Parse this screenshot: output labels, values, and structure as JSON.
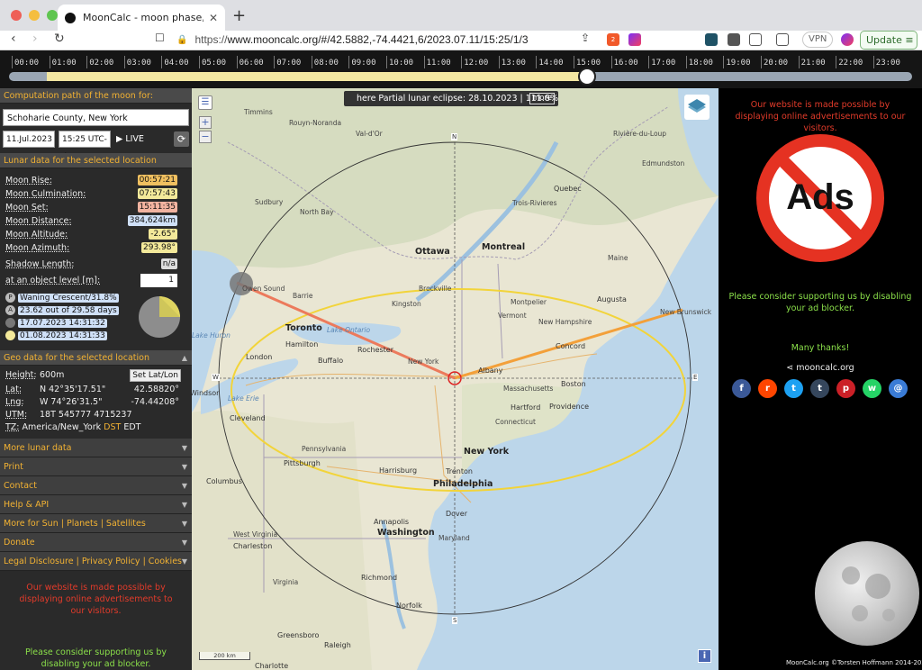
{
  "browser": {
    "tab_title": "MoonCalc - moon phase, lunar",
    "url_scheme": "https://",
    "url_host": "www.mooncalc.org",
    "url_path": "/#/42.5882,-74.4421,6/2023.07.11/15:25/1/3",
    "vpn_label": "VPN",
    "update_label": "Update",
    "shield_badge": "2"
  },
  "timeline": {
    "hours": [
      "00:00",
      "01:00",
      "02:00",
      "03:00",
      "04:00",
      "05:00",
      "06:00",
      "07:00",
      "08:00",
      "09:00",
      "10:00",
      "11:00",
      "12:00",
      "13:00",
      "14:00",
      "15:00",
      "16:00",
      "17:00",
      "18:00",
      "19:00",
      "20:00",
      "21:00",
      "22:00",
      "23:00"
    ],
    "current_time_fraction": 0.64
  },
  "left": {
    "computation_header": "Computation path of the moon for:",
    "location": "Schoharie County, New York",
    "date": "11.Jul.2023",
    "time": "15:25 UTC-4",
    "live_label": "LIVE",
    "lunar_header": "Lunar data for the selected location",
    "lunar": [
      {
        "key": "Moon Rise:",
        "value": "00:57:21",
        "color": "#f0c060"
      },
      {
        "key": "Moon Culmination:",
        "value": "07:57:43",
        "color": "#f3e99a"
      },
      {
        "key": "Moon Set:",
        "value": "15:11:35",
        "color": "#f2b3a0"
      },
      {
        "key": "Moon Distance:",
        "value": "384,624km",
        "color": "#cfe0f7"
      },
      {
        "key": "Moon Altitude:",
        "value": "-2.65°",
        "color": "#f3e99a"
      },
      {
        "key": "Moon Azimuth:",
        "value": "293.98°",
        "color": "#f3e99a"
      }
    ],
    "shadow_label": "Shadow Length:",
    "shadow_value": "n/a",
    "object_label": "at an object level [m]:",
    "object_value": "1",
    "phases": [
      {
        "marker": "P",
        "text": "Waning Crescent/31.8%",
        "dot": "#bbbbbb"
      },
      {
        "marker": "A",
        "text": "23.62 out of 29.58 days",
        "dot": "#bbbbbb"
      },
      {
        "marker": "",
        "text": "17.07.2023 14:31:32",
        "dot": "#777777"
      },
      {
        "marker": "",
        "text": "01.08.2023 14:31:33",
        "dot": "#f3e99a"
      }
    ],
    "geo_header": "Geo data for the selected location",
    "geo": {
      "height_label": "Height:",
      "height_value": "600m",
      "set_button": "Set Lat/Lon",
      "lat_label": "Lat:",
      "lat_dms": "N 42°35'17.51\"",
      "lat_dec": "42.58820°",
      "lng_label": "Lng:",
      "lng_dms": "W 74°26'31.5\"",
      "lng_dec": "-74.44208°",
      "utm_label": "UTM:",
      "utm_value": "18T 545777 4715237",
      "tz_label": "TZ:",
      "tz_value": "America/New_York",
      "tz_dst": "DST",
      "tz_abbr": "EDT"
    },
    "menus": [
      "More lunar data",
      "Print",
      "Contact",
      "Help & API",
      "More for Sun | Planets | Satellites",
      "Donate",
      "Legal Disclosure | Privacy Policy | Cookies"
    ],
    "ad_text": "Our website is made possible by displaying online advertisements to our visitors.",
    "support_text": "Please consider supporting us by disabling your ad blocker."
  },
  "map": {
    "eclipse_text": "here Partial lunar eclipse: 28.10.2023 | 111.8%",
    "more_label": "more",
    "scale_label": "200 km",
    "compass": {
      "n": "N",
      "s": "S",
      "e": "E",
      "w": "W"
    },
    "cities": [
      {
        "name": "Timmins",
        "cls": "small"
      },
      {
        "name": "Rouyn-Noranda",
        "cls": "small"
      },
      {
        "name": "Val-d'Or",
        "cls": "small"
      },
      {
        "name": "Rivière-du-Loup",
        "cls": "small"
      },
      {
        "name": "Edmundston",
        "cls": "small"
      },
      {
        "name": "Sudbury",
        "cls": "small"
      },
      {
        "name": "North Bay",
        "cls": "small"
      },
      {
        "name": "Quebec",
        "cls": ""
      },
      {
        "name": "Trois-Rivieres",
        "cls": "small"
      },
      {
        "name": "Ottawa",
        "cls": "big"
      },
      {
        "name": "Montreal",
        "cls": "big"
      },
      {
        "name": "Maine",
        "cls": "small"
      },
      {
        "name": "Owen Sound",
        "cls": "small"
      },
      {
        "name": "Barrie",
        "cls": "small"
      },
      {
        "name": "Brockville",
        "cls": "small"
      },
      {
        "name": "Kingston",
        "cls": "small"
      },
      {
        "name": "Montpelier",
        "cls": "small"
      },
      {
        "name": "Augusta",
        "cls": ""
      },
      {
        "name": "Vermont",
        "cls": "small"
      },
      {
        "name": "New Hampshire",
        "cls": "small"
      },
      {
        "name": "Toronto",
        "cls": "big"
      },
      {
        "name": "Hamilton",
        "cls": ""
      },
      {
        "name": "Rochester",
        "cls": ""
      },
      {
        "name": "Concord",
        "cls": ""
      },
      {
        "name": "London",
        "cls": ""
      },
      {
        "name": "Buffalo",
        "cls": ""
      },
      {
        "name": "New York",
        "cls": "small"
      },
      {
        "name": "Albany",
        "cls": ""
      },
      {
        "name": "Massachusetts",
        "cls": "small"
      },
      {
        "name": "Boston",
        "cls": ""
      },
      {
        "name": "Windsor",
        "cls": ""
      },
      {
        "name": "Hartford",
        "cls": ""
      },
      {
        "name": "Providence",
        "cls": ""
      },
      {
        "name": "Cleveland",
        "cls": ""
      },
      {
        "name": "Connecticut",
        "cls": "small"
      },
      {
        "name": "Pennsylvania",
        "cls": "small"
      },
      {
        "name": "New York",
        "cls": "big"
      },
      {
        "name": "Pittsburgh",
        "cls": ""
      },
      {
        "name": "Harrisburg",
        "cls": ""
      },
      {
        "name": "Trenton",
        "cls": ""
      },
      {
        "name": "Columbus",
        "cls": ""
      },
      {
        "name": "Philadelphia",
        "cls": "big"
      },
      {
        "name": "Dover",
        "cls": ""
      },
      {
        "name": "Annapolis",
        "cls": ""
      },
      {
        "name": "Washington",
        "cls": "big"
      },
      {
        "name": "Maryland",
        "cls": "small"
      },
      {
        "name": "West Virginia",
        "cls": "small"
      },
      {
        "name": "Charleston",
        "cls": ""
      },
      {
        "name": "Richmond",
        "cls": ""
      },
      {
        "name": "Virginia",
        "cls": "small"
      },
      {
        "name": "Norfolk",
        "cls": ""
      },
      {
        "name": "Greensboro",
        "cls": ""
      },
      {
        "name": "Raleigh",
        "cls": ""
      },
      {
        "name": "Charlotte",
        "cls": ""
      },
      {
        "name": "Lake Huron",
        "cls": "water"
      },
      {
        "name": "Lake Ontario",
        "cls": "water"
      },
      {
        "name": "Lake Erie",
        "cls": "water"
      },
      {
        "name": "New Brunswick",
        "cls": "small"
      }
    ]
  },
  "right": {
    "ad_text": "Our website is made possible by displaying online advertisements to our visitors.",
    "ads_badge": "Ads",
    "support_text": "Please consider supporting us by disabling your ad blocker.",
    "thanks": "Many thanks!",
    "share_label": "mooncalc.org",
    "social": [
      {
        "name": "facebook",
        "glyph": "f",
        "color": "#3b5998"
      },
      {
        "name": "reddit",
        "glyph": "r",
        "color": "#ff4500"
      },
      {
        "name": "twitter",
        "glyph": "t",
        "color": "#1da1f2"
      },
      {
        "name": "tumblr",
        "glyph": "t",
        "color": "#35465c"
      },
      {
        "name": "pinterest",
        "glyph": "p",
        "color": "#cb2027"
      },
      {
        "name": "whatsapp",
        "glyph": "w",
        "color": "#25d366"
      },
      {
        "name": "email",
        "glyph": "@",
        "color": "#3a7bd5"
      }
    ],
    "copyright": "MoonCalc.org ©Torsten Hoffmann 2014-2023"
  }
}
